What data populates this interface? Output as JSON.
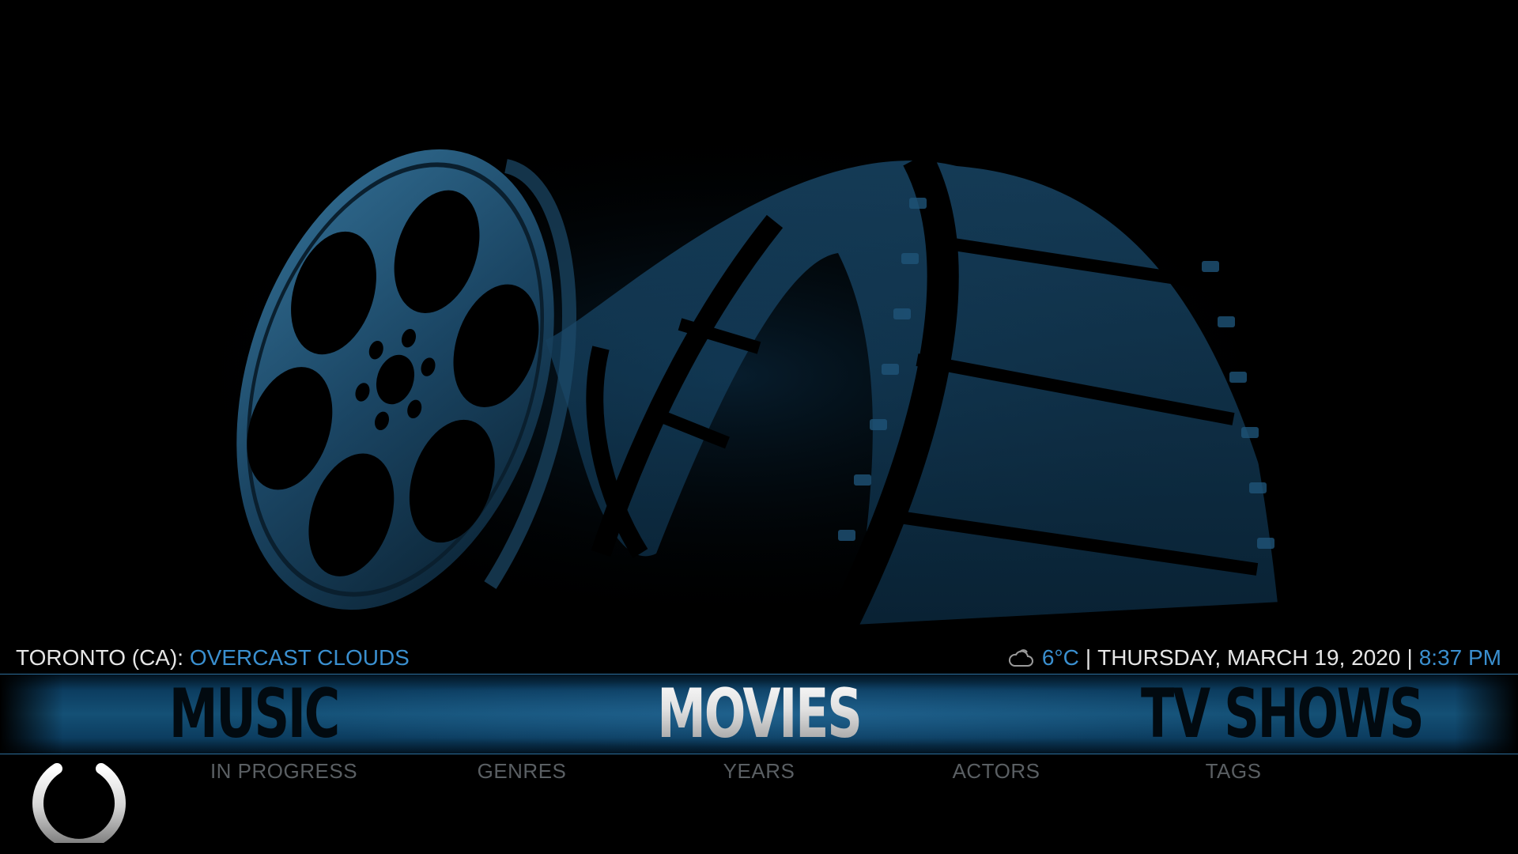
{
  "info": {
    "location": "TORONTO (CA):",
    "condition": "OVERCAST CLOUDS",
    "temperature": "6°C",
    "separator": "|",
    "date": "THURSDAY, MARCH 19, 2020",
    "time": "8:37 PM"
  },
  "menu": {
    "items": [
      {
        "label": "MUSIC"
      },
      {
        "label": "MOVIES"
      },
      {
        "label": "TV SHOWS"
      }
    ],
    "selected": "MOVIES"
  },
  "submenu": {
    "items": [
      {
        "label": "IN PROGRESS"
      },
      {
        "label": "GENRES"
      },
      {
        "label": "YEARS"
      },
      {
        "label": "ACTORS"
      },
      {
        "label": "TAGS"
      }
    ]
  },
  "icons": {
    "weather": "cloud-icon",
    "power": "power-icon"
  },
  "colors": {
    "accent": "#3a8fcf",
    "menu_bar": "#145075",
    "submenu_text": "#5a5f63",
    "info_text": "#e6e6e6"
  }
}
